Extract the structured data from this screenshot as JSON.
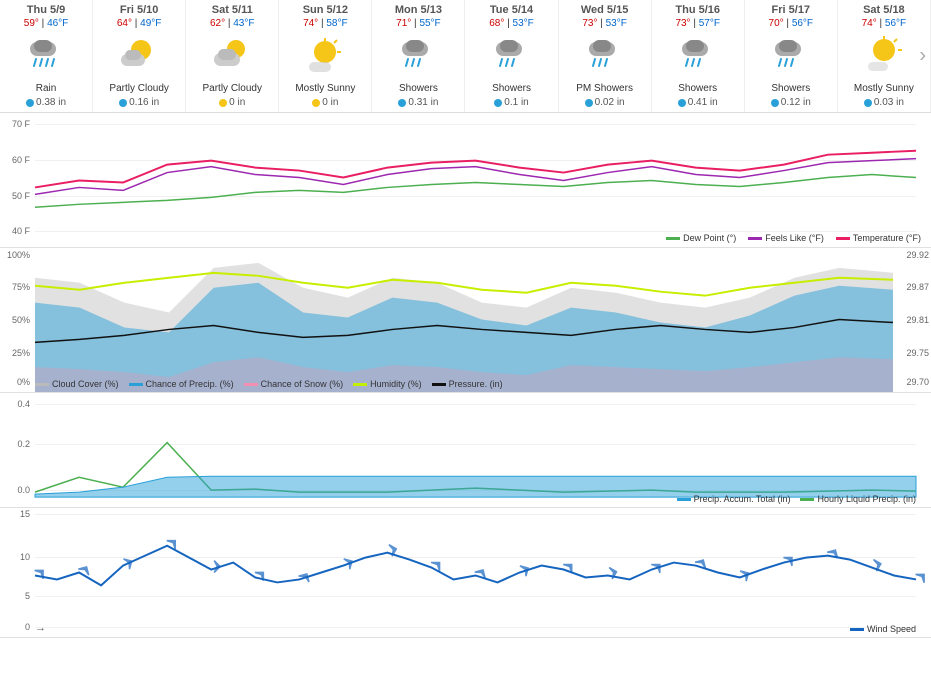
{
  "header": {
    "nav_next": "›",
    "days": [
      {
        "id": "thu-59",
        "label": "Thu 5/9",
        "high": "59°",
        "low": "46°F",
        "desc": "Rain",
        "icon": "rain",
        "precip": "0.38 in",
        "precip_type": "rain"
      },
      {
        "id": "fri-510",
        "label": "Fri 5/10",
        "high": "64°",
        "low": "49°F",
        "desc": "Partly Cloudy",
        "icon": "partly-cloudy",
        "precip": "0.16 in",
        "precip_type": "rain"
      },
      {
        "id": "sat-511",
        "label": "Sat 5/11",
        "high": "62°",
        "low": "43°F",
        "desc": "Partly Cloudy",
        "icon": "partly-cloudy",
        "precip": "0 in",
        "precip_type": "snow"
      },
      {
        "id": "sun-512",
        "label": "Sun 5/12",
        "high": "74°",
        "low": "58°F",
        "desc": "Mostly Sunny",
        "icon": "mostly-sunny",
        "precip": "0 in",
        "precip_type": "snow"
      },
      {
        "id": "mon-513",
        "label": "Mon 5/13",
        "high": "71°",
        "low": "55°F",
        "desc": "Showers",
        "icon": "showers",
        "precip": "0.31 in",
        "precip_type": "rain"
      },
      {
        "id": "tue-514",
        "label": "Tue 5/14",
        "high": "68°",
        "low": "53°F",
        "desc": "Showers",
        "icon": "showers",
        "precip": "0.1 in",
        "precip_type": "rain"
      },
      {
        "id": "wed-515",
        "label": "Wed 5/15",
        "high": "73°",
        "low": "53°F",
        "desc": "PM Showers",
        "icon": "showers",
        "precip": "0.02 in",
        "precip_type": "rain"
      },
      {
        "id": "thu-516",
        "label": "Thu 5/16",
        "high": "73°",
        "low": "57°F",
        "desc": "Showers",
        "icon": "showers",
        "precip": "0.41 in",
        "precip_type": "rain"
      },
      {
        "id": "fri-517",
        "label": "Fri 5/17",
        "high": "70°",
        "low": "56°F",
        "desc": "Showers",
        "icon": "showers",
        "precip": "0.12 in",
        "precip_type": "rain"
      },
      {
        "id": "sat-518",
        "label": "Sat 5/18",
        "high": "74°",
        "low": "56°F",
        "desc": "Mostly Sunny",
        "icon": "mostly-sunny",
        "precip": "0.03 in",
        "precip_type": "rain"
      }
    ]
  },
  "temp_chart": {
    "y_labels": [
      "70 F",
      "60 F",
      "50 F",
      "40 F"
    ],
    "legend": [
      {
        "label": "Dew Point (°)",
        "color": "#4caf50"
      },
      {
        "label": "Feels Like (°F)",
        "color": "#9c27b0"
      },
      {
        "label": "Temperature (°F)",
        "color": "#e91e63"
      }
    ]
  },
  "precip_chart": {
    "y_labels": [
      "100%",
      "75%",
      "50%",
      "25%",
      "0%"
    ],
    "y_labels_right": [
      "29.92",
      "29.87",
      "29.81",
      "29.75",
      "29.70"
    ],
    "legend": [
      {
        "label": "Cloud Cover (%)",
        "color": "#bbb"
      },
      {
        "label": "Chance of Precip. (%)",
        "color": "#29a0d8"
      },
      {
        "label": "Chance of Snow (%)",
        "color": "#f48fb1"
      },
      {
        "label": "Humidity (%)",
        "color": "#c6ef00"
      },
      {
        "label": "Pressure. (in)",
        "color": "#111"
      }
    ]
  },
  "accum_chart": {
    "y_labels": [
      "0.4",
      "0.2",
      "0.0"
    ],
    "legend": [
      {
        "label": "Precip. Accum. Total (in)",
        "color": "#29a0d8"
      },
      {
        "label": "Hourly Liquid Precip. (in)",
        "color": "#4caf50"
      }
    ]
  },
  "wind_chart": {
    "y_labels": [
      "15",
      "10",
      "5",
      "0"
    ],
    "legend": [
      {
        "label": "Wind Speed",
        "color": "#1565c0"
      }
    ],
    "arrow_label": "→"
  }
}
